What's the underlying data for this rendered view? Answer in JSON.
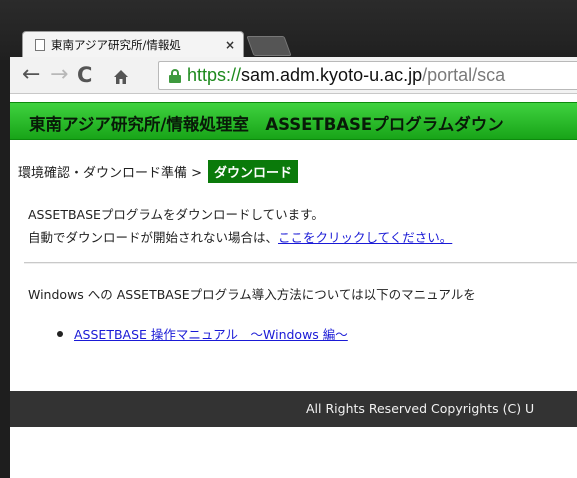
{
  "browser": {
    "tab_title": "東南アジア研究所/情報処",
    "tab_close": "×",
    "url_scheme": "https://",
    "url_host": "sam.adm.kyoto-u.ac.jp",
    "url_path": "/portal/sca",
    "nav": {
      "back": "←",
      "forward": "→",
      "reload": "C"
    }
  },
  "banner": {
    "title": "東南アジア研究所/情報処理室　ASSETBASEプログラムダウン"
  },
  "breadcrumb": {
    "step1": "環境確認・ダウンロード準備 >",
    "current": "ダウンロード"
  },
  "main": {
    "line1": "ASSETBASEプログラムをダウンロードしています。",
    "line2_prefix": "自動でダウンロードが開始されない場合は、",
    "line2_link": "ここをクリックしてください。",
    "line3": "Windows への ASSETBASEプログラム導入方法については以下のマニュアルを",
    "manual_link": "ASSETBASE 操作マニュアル　～Windows 編～"
  },
  "footer": {
    "text": "All Rights Reserved Copyrights (C) U"
  },
  "colors": {
    "banner_green": "#18a418",
    "active_crumb": "#0a7a0a",
    "link_blue": "#1a1ad6",
    "footer_bg": "#333333"
  }
}
